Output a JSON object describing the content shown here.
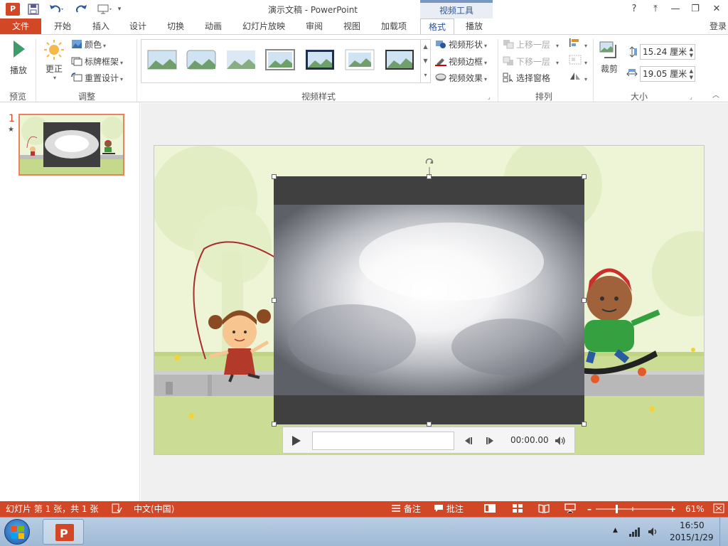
{
  "window": {
    "title": "演示文稿 - PowerPoint",
    "context_tab_header": "视频工具",
    "app_logo": "P",
    "help": "?",
    "ribbon_display": "⤒",
    "minimize": "—",
    "restore": "❐",
    "close": "✕"
  },
  "quick_access": {
    "save_icon": "save-icon",
    "undo_icon": "undo-icon",
    "redo_icon": "redo-icon",
    "start_icon": "slideshow-from-start-icon"
  },
  "tabs": [
    {
      "label": "文件"
    },
    {
      "label": "开始"
    },
    {
      "label": "插入"
    },
    {
      "label": "设计"
    },
    {
      "label": "切换"
    },
    {
      "label": "动画"
    },
    {
      "label": "幻灯片放映"
    },
    {
      "label": "审阅"
    },
    {
      "label": "视图"
    },
    {
      "label": "加载项"
    },
    {
      "label": "格式"
    },
    {
      "label": "播放"
    }
  ],
  "login": "登录",
  "ribbon": {
    "preview": {
      "play": "播放",
      "group": "预览"
    },
    "adjust": {
      "corrections": "更正",
      "color": "颜色",
      "poster_frame": "标牌框架",
      "reset_design": "重置设计",
      "group": "调整"
    },
    "video_styles": {
      "shape": "视频形状",
      "border": "视频边框",
      "effects": "视频效果",
      "group": "视频样式"
    },
    "arrange": {
      "bring_forward": "上移一层",
      "send_backward": "下移一层",
      "selection_pane": "选择窗格",
      "group": "排列"
    },
    "size": {
      "crop": "裁剪",
      "height": "15.24 厘米",
      "width": "19.05 厘米",
      "group": "大小"
    }
  },
  "thumbs": {
    "slide_number": "1",
    "star": "★"
  },
  "media_controls": {
    "time": "00:00.00"
  },
  "status": {
    "slide_info": "幻灯片 第 1 张，共 1 张",
    "language": "中文(中国)",
    "notes": "备注",
    "comments": "批注",
    "zoom": "61%"
  },
  "taskbar": {
    "time": "16:50",
    "date": "2015/1/29"
  },
  "colors": {
    "accent": "#d24726",
    "format_tab": "#2a5699",
    "slide_bg": "#eef5d6"
  }
}
